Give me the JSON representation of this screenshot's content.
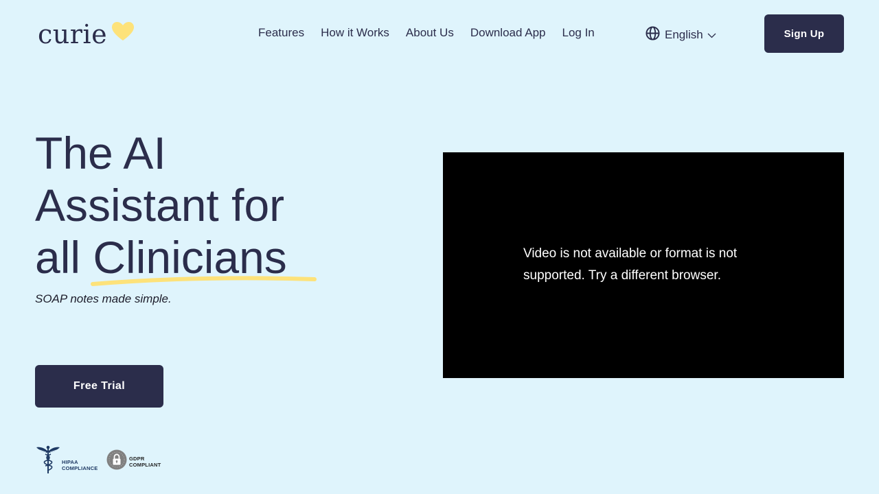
{
  "header": {
    "logo_text": "curie",
    "nav": [
      {
        "label": "Features"
      },
      {
        "label": "How it Works"
      },
      {
        "label": "About Us"
      },
      {
        "label": "Download App"
      },
      {
        "label": "Log In"
      }
    ],
    "language": "English",
    "signup_label": "Sign Up"
  },
  "hero": {
    "headline_line1": "The AI",
    "headline_line2": "Assistant for",
    "headline_line3": "all Clinicians",
    "subtitle": "SOAP notes made simple.",
    "cta_label": "Free Trial"
  },
  "video": {
    "message": "Video is not available or format is not supported. Try a different browser."
  },
  "badges": {
    "hipaa_line1": "HIPAA",
    "hipaa_line2": "COMPLIANCE",
    "gdpr_line1": "GDPR",
    "gdpr_line2": "COMPLIANT"
  },
  "colors": {
    "background": "#dff4fc",
    "primary": "#2b2d4b",
    "accent_yellow": "#fde27a"
  },
  "icons": [
    "heart-logo-icon",
    "globe-icon",
    "chevron-down-icon",
    "caduceus-icon",
    "lock-icon"
  ]
}
